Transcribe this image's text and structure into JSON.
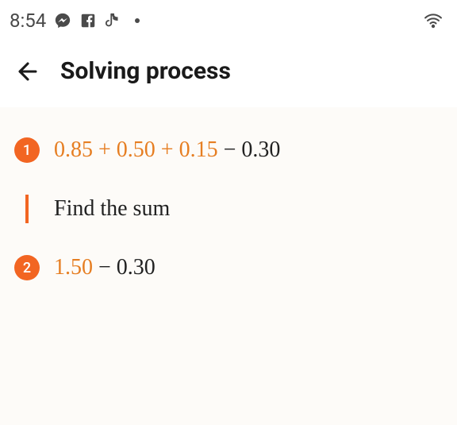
{
  "status_bar": {
    "time": "8:54",
    "icons": [
      "messenger",
      "facebook",
      "tiktok"
    ]
  },
  "header": {
    "title": "Solving process"
  },
  "steps": [
    {
      "number": "1",
      "expr_orange": "0.85 + 0.50 + 0.15",
      "expr_rest": " − 0.30"
    },
    {
      "number": "2",
      "expr_orange": "1.50",
      "expr_rest": " − 0.30"
    }
  ],
  "instruction": {
    "text": "Find the sum"
  },
  "colors": {
    "accent": "#f26522",
    "orange_text": "#e67e22"
  }
}
